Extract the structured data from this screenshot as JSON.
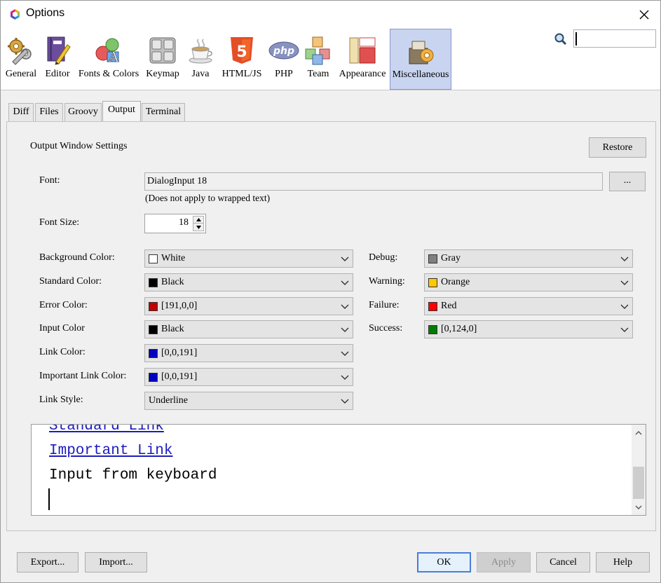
{
  "window": {
    "title": "Options"
  },
  "categories": [
    {
      "id": "general",
      "label": "General",
      "icon": "gears-icon"
    },
    {
      "id": "editor",
      "label": "Editor",
      "icon": "book-pencil-icon"
    },
    {
      "id": "fonts",
      "label": "Fonts & Colors",
      "icon": "shapes-letter-icon"
    },
    {
      "id": "keymap",
      "label": "Keymap",
      "icon": "keyboard-icon"
    },
    {
      "id": "java",
      "label": "Java",
      "icon": "coffee-cup-icon"
    },
    {
      "id": "html",
      "label": "HTML/JS",
      "icon": "html5-icon"
    },
    {
      "id": "php",
      "label": "PHP",
      "icon": "php-icon"
    },
    {
      "id": "team",
      "label": "Team",
      "icon": "cubes-icon"
    },
    {
      "id": "appearance",
      "label": "Appearance",
      "icon": "layout-icon"
    },
    {
      "id": "misc",
      "label": "Miscellaneous",
      "icon": "toolbox-gear-icon"
    }
  ],
  "selected_category": "Miscellaneous",
  "search": {
    "value": ""
  },
  "tabs": [
    "Diff",
    "Files",
    "Groovy",
    "Output",
    "Terminal"
  ],
  "active_tab": "Output",
  "section": {
    "title": "Output Window Settings",
    "restore_label": "Restore"
  },
  "font": {
    "label": "Font:",
    "value": "DialogInput 18",
    "browse_label": "...",
    "note": "(Does not apply to wrapped text)"
  },
  "font_size": {
    "label": "Font Size:",
    "value": "18"
  },
  "left_colors": [
    {
      "label": "Background Color:",
      "value": "White",
      "swatch": "#ffffff"
    },
    {
      "label": "Standard Color:",
      "value": "Black",
      "swatch": "#000000"
    },
    {
      "label": "Error Color:",
      "value": "[191,0,0]",
      "swatch": "#bf0000"
    },
    {
      "label": "Input Color",
      "value": "Black",
      "swatch": "#000000"
    },
    {
      "label": "Link Color:",
      "value": "[0,0,191]",
      "swatch": "#0000bf"
    },
    {
      "label": "Important Link Color:",
      "value": "[0,0,191]",
      "swatch": "#0000bf"
    }
  ],
  "link_style": {
    "label": "Link Style:",
    "value": "Underline"
  },
  "right_colors": [
    {
      "label": "Debug:",
      "value": "Gray",
      "swatch": "#808080"
    },
    {
      "label": "Warning:",
      "value": "Orange",
      "swatch": "#ffc800"
    },
    {
      "label": "Failure:",
      "value": "Red",
      "swatch": "#ff0000"
    },
    {
      "label": "Success:",
      "value": "[0,124,0]",
      "swatch": "#007c00"
    }
  ],
  "preview": {
    "standard_link": "Standard Link",
    "important_link": "Important Link",
    "input_text": "Input from keyboard"
  },
  "footer": {
    "export_label": "Export...",
    "import_label": "Import...",
    "ok_label": "OK",
    "apply_label": "Apply",
    "cancel_label": "Cancel",
    "help_label": "Help"
  },
  "colors": {
    "selection_bg": "#c9d5f0",
    "link_blue": "#1c1cbf",
    "ok_border": "#4a7dd8"
  }
}
